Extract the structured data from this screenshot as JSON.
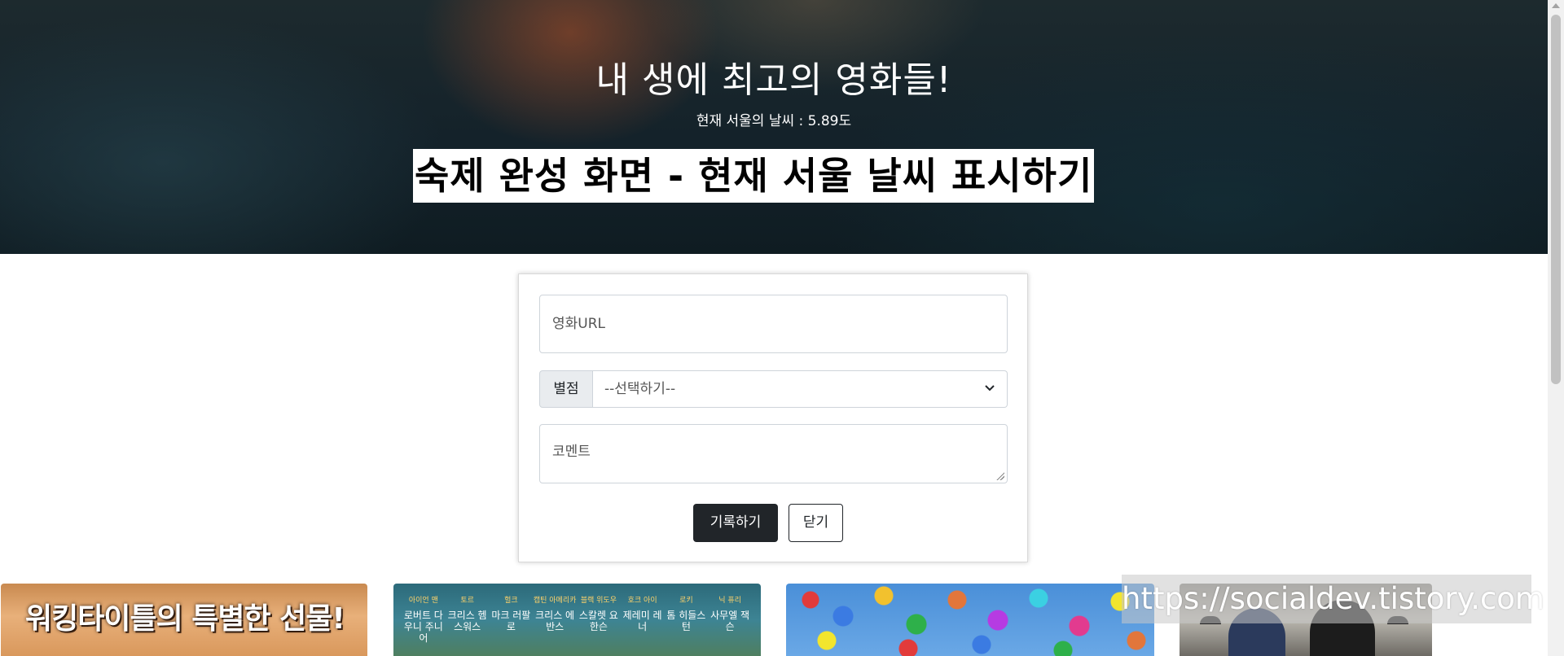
{
  "hero": {
    "title": "내 생에 최고의 영화들!",
    "weather_text": "현재 서울의 날씨 : 5.89도",
    "caption": "숙제 완성 화면 - 현재 서울 날씨 표시하기"
  },
  "form": {
    "url_placeholder": "영화URL",
    "star_label": "별점",
    "star_select_value": "--선택하기--",
    "comment_placeholder": "코멘트",
    "save_label": "기록하기",
    "close_label": "닫기"
  },
  "movies": [
    {
      "poster_text": "워킹타이틀의 특별한 선물!"
    },
    {
      "cast": [
        {
          "role": "아이언 맨",
          "name": "로버트 다우니 주니어"
        },
        {
          "role": "토르",
          "name": "크리스 헴스워스"
        },
        {
          "role": "헐크",
          "name": "마크 러팔로"
        },
        {
          "role": "캡틴 아메리카",
          "name": "크리스 에반스"
        },
        {
          "role": "블랙 위도우",
          "name": "스칼렛 요한슨"
        },
        {
          "role": "호크 아이",
          "name": "제레미 레너"
        },
        {
          "role": "로키",
          "name": "톰 히들스턴"
        },
        {
          "role": "닉 퓨리",
          "name": "사무엘 잭슨"
        }
      ]
    },
    {
      "poster_text": ""
    },
    {
      "poster_text": ""
    }
  ],
  "watermark": "https://socialdev.tistory.com",
  "colors": {
    "button_dark": "#212529",
    "input_border": "#ced4da",
    "group_label_bg": "#e9ecef"
  },
  "icons": {
    "select_arrow": "chevron-down-icon",
    "scroll_up": "arrow-up-icon"
  }
}
